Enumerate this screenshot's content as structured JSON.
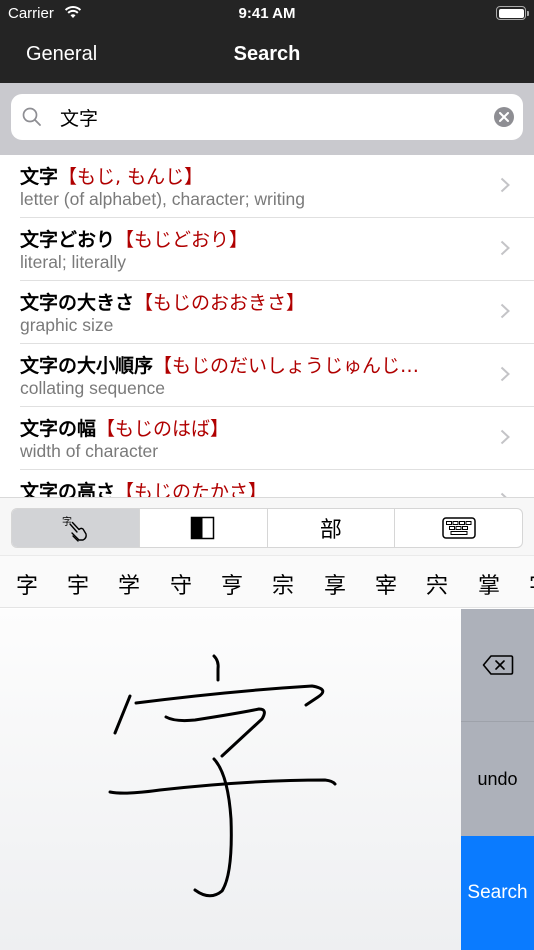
{
  "status_bar": {
    "carrier": "Carrier",
    "time": "9:41 AM",
    "battery_percent": 100
  },
  "nav": {
    "back_label": "General",
    "title": "Search"
  },
  "search": {
    "value": "文字",
    "placeholder": "",
    "icon": "search-icon",
    "clear_icon": "clear-icon"
  },
  "results": [
    {
      "kanji": "文字",
      "reading": "【もじ, もんじ】",
      "meaning": "letter (of alphabet), character; writing"
    },
    {
      "kanji": "文字どおり",
      "reading": "【もじどおり】",
      "meaning": "literal; literally"
    },
    {
      "kanji": "文字の大きさ",
      "reading": "【もじのおおきさ】",
      "meaning": "graphic size"
    },
    {
      "kanji": "文字の大小順序",
      "reading": "【もじのだいしょうじゅんじ…",
      "meaning": "collating sequence"
    },
    {
      "kanji": "文字の幅",
      "reading": "【もじのはば】",
      "meaning": "width of character"
    },
    {
      "kanji": "文字の高さ",
      "reading": "【もじのたかさ】",
      "meaning": ""
    }
  ],
  "input_modes": [
    {
      "name": "handwriting",
      "icon": "handwriting-icon",
      "active": true
    },
    {
      "name": "contrast",
      "icon": "contrast-icon",
      "active": false
    },
    {
      "name": "radical",
      "label": "部",
      "active": false
    },
    {
      "name": "keyboard",
      "icon": "keyboard-icon",
      "active": false
    }
  ],
  "candidates": [
    "字",
    "宇",
    "学",
    "守",
    "亨",
    "宗",
    "享",
    "宰",
    "宍",
    "掌",
    "字"
  ],
  "side_buttons": {
    "backspace_icon": "backspace-icon",
    "undo_label": "undo",
    "search_label": "Search"
  },
  "colors": {
    "nav_bg": "#242424",
    "reading": "#b00000",
    "search_button": "#0a7bff",
    "side_button": "#adb1ba"
  },
  "handwriting": {
    "recognized_character": "字"
  }
}
